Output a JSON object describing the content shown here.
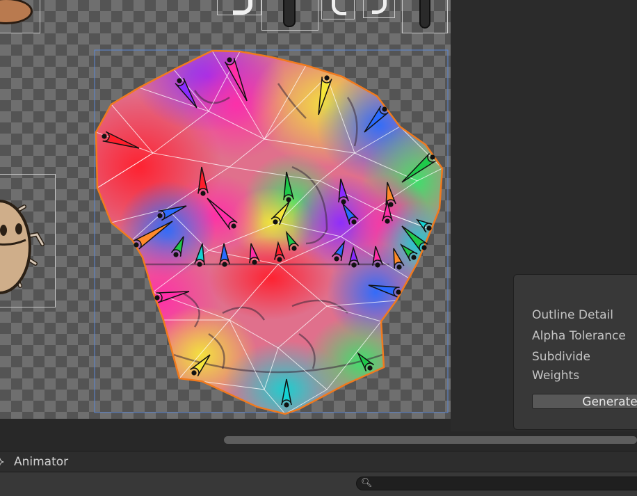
{
  "skinning_panel": {
    "labels": [
      "Outline Detail",
      "Alpha Tolerance",
      "Subdivide",
      "Weights"
    ],
    "generate_button": "Generate"
  },
  "animator_tab": {
    "title": "Animator",
    "icon": "animator-icon"
  },
  "search": {
    "icon": "search-icon",
    "placeholder": "",
    "value": ""
  },
  "colors": {
    "outline": "#f07a1e",
    "rect_selection": "#5b87d6",
    "mesh_edges": "#ffffff",
    "panel_bg": "#383838",
    "editor_bg": "#282828"
  }
}
